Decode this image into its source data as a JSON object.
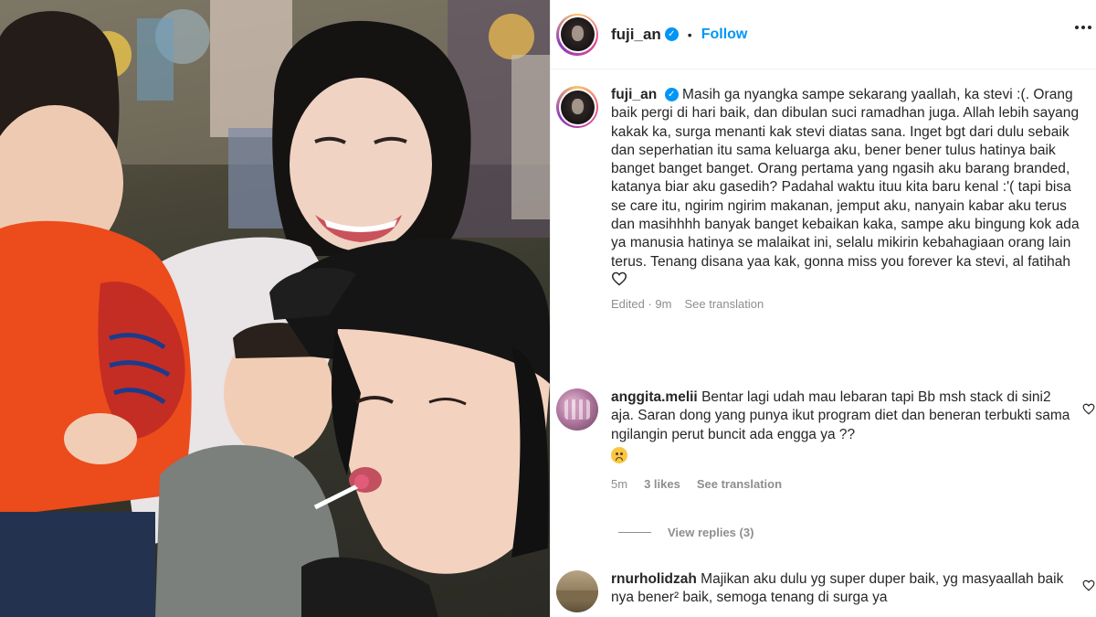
{
  "post": {
    "username": "fuji_an",
    "separator": "•",
    "follow_label": "Follow",
    "caption": "Masih ga nyangka sampe sekarang yaallah, ka stevi :(. Orang baik pergi di hari baik, dan dibulan suci ramadhan juga. Allah lebih sayang kakak ka, surga menanti kak stevi diatas sana. Inget bgt dari dulu sebaik dan seperhatian itu sama keluarga aku, bener bener tulus hatinya baik banget banget banget. Orang pertama yang ngasih aku barang branded, katanya biar aku gasedih? Padahal waktu ituu kita baru kenal :'( tapi bisa se care itu, ngirim ngirim makanan, jemput aku, nanyain kabar aku terus dan masihhhh banyak banget kebaikan kaka, sampe aku bingung kok ada ya manusia hatinya se malaikat ini, selalu mikirin kebahagiaan orang lain terus. Tenang disana yaa kak, gonna miss you forever ka stevi, al fatihah",
    "edited_label": "Edited · 9m",
    "see_translation": "See translation"
  },
  "comments": [
    {
      "username": "anggita.melii",
      "text": "Bentar lagi udah mau lebaran tapi Bb msh stack di sini2 aja. Saran dong yang punya ikut program diet dan beneran terbukti sama ngilangin perut buncit ada engga ya ??",
      "time": "5m",
      "likes": "3 likes",
      "see_translation": "See translation",
      "view_replies": "View replies (3)"
    },
    {
      "username": "rnurholidzah",
      "text": "Majikan aku dulu yg super duper baik, yg masyaallah baik nya bener² baik, semoga tenang di surga ya"
    }
  ],
  "icons": [
    "verified-badge-icon",
    "more-options-icon",
    "heart-outline-icon",
    "sad-face-emoji",
    "comment-like-icon"
  ],
  "colors": {
    "accent": "#0095f6",
    "text": "#262626",
    "muted": "#8e8e8e"
  }
}
